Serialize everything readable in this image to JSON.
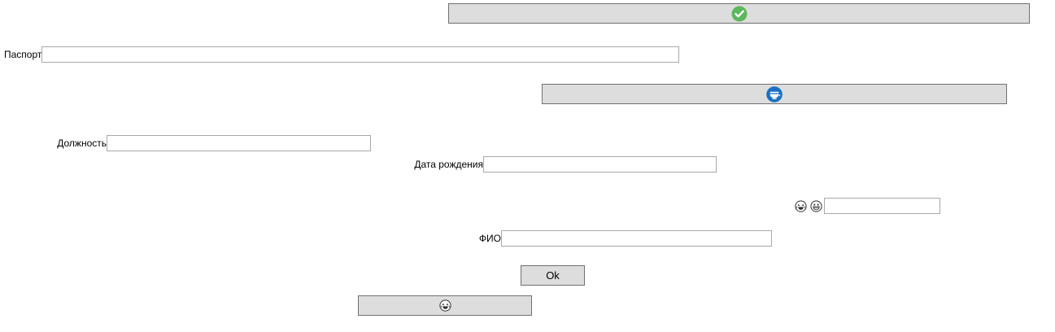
{
  "form": {
    "passport_label": "Паспорт",
    "passport_value": "",
    "position_label": "Должность",
    "position_value": "",
    "birthdate_label": "Дата рождения",
    "birthdate_value": "",
    "fio_label": "ФИО",
    "fio_value": "",
    "emoji_field_value": "",
    "ok_label": "Ok"
  },
  "icons": {
    "confirm_button_icon": "check-circle-icon",
    "middle_button_icon": "bowl-icon",
    "emoji_label_icons": [
      "laughing-face-icon",
      "grinning-face-icon"
    ],
    "bottom_button_icon": "laughing-face-icon"
  },
  "colors": {
    "check_green": "#5cb85c",
    "bowl_blue": "#1a6fc2",
    "button_bg": "#dddddd",
    "button_border": "#707070",
    "field_border": "#a9a9a9"
  }
}
